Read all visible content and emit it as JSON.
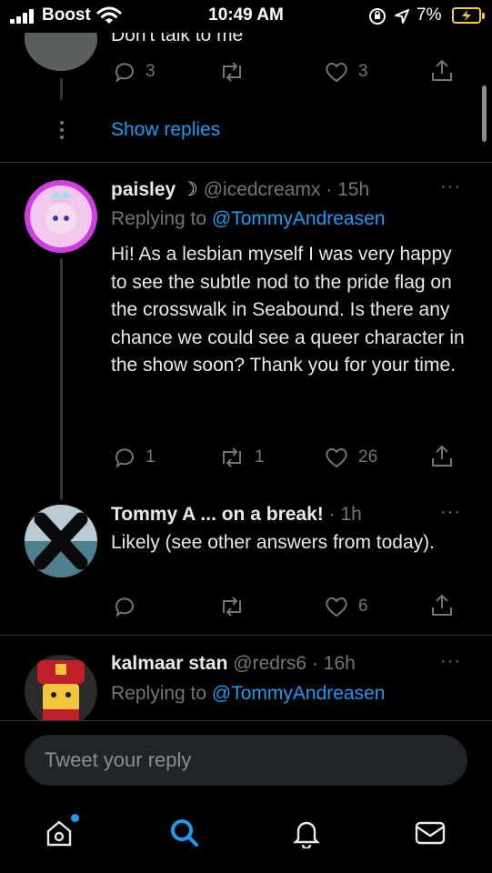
{
  "status_bar": {
    "carrier": "Boost",
    "time": "10:49 AM",
    "battery_pct": "7%"
  },
  "top_tweet": {
    "text": "Don't talk to me",
    "reply_count": "3",
    "retweet_count": "",
    "like_count": "3",
    "show_replies": "Show replies"
  },
  "tweets": [
    {
      "name": "paisley ☽",
      "handle": "@icedcreamx",
      "dot": "·",
      "time": "15h",
      "replying_prefix": "Replying to",
      "replying_to": "@TommyAndreasen",
      "text": "Hi! As a lesbian myself I was very happy to see the subtle nod to the pride flag on the crosswalk in Seabound. Is there any chance we could see a queer character in the show soon? Thank you for your time.",
      "reply_count": "1",
      "retweet_count": "1",
      "like_count": "26",
      "more": "···"
    },
    {
      "name": "Tommy A ... on a break!",
      "dot": "·",
      "time": "1h",
      "text": "Likely (see other answers from today).",
      "reply_count": "",
      "retweet_count": "",
      "like_count": "6",
      "more": "···"
    },
    {
      "name": "kalmaar stan",
      "handle": "@redrs6",
      "dot": "·",
      "time": "16h",
      "replying_prefix": "Replying to",
      "replying_to": "@TommyAndreasen",
      "more": "···"
    }
  ],
  "reply_bar": {
    "placeholder": "Tweet your reply"
  },
  "tab_bar": {
    "active": "search",
    "accent": "#1d9bf0"
  },
  "colors": {
    "background": "#000000",
    "text": "#e7e9ea",
    "muted": "#71767b",
    "link": "#1d9bf0"
  }
}
